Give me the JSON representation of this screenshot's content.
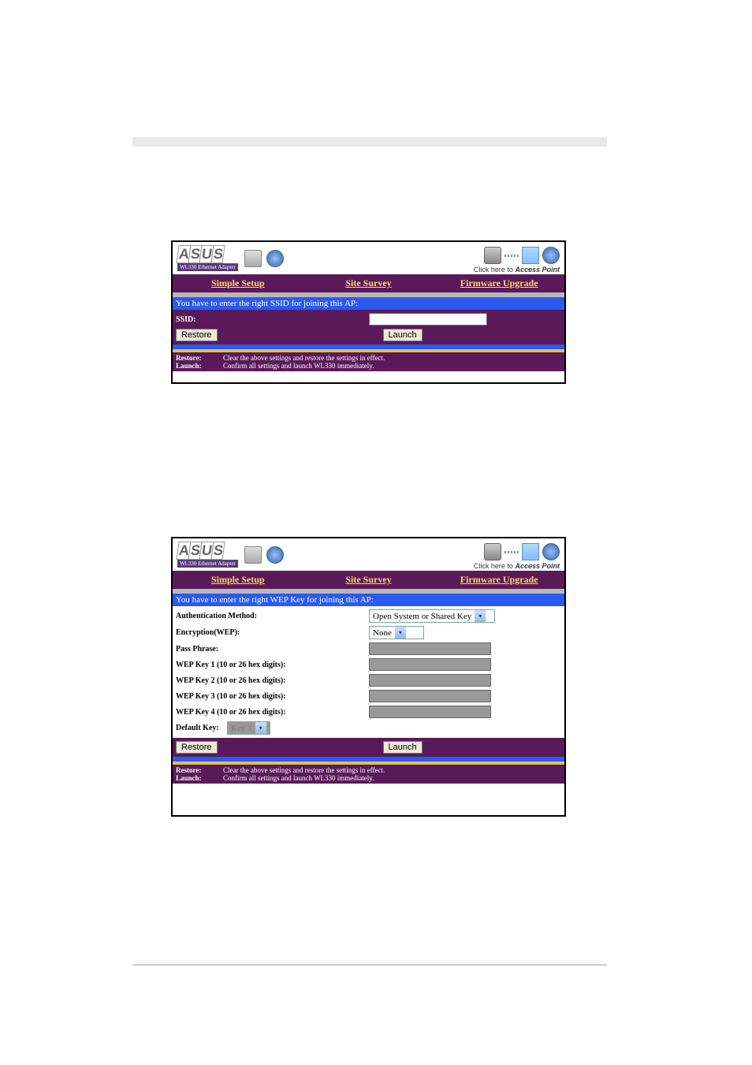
{
  "product_name": "WL330 Ethernet Adapter",
  "ap_link": "Click here to",
  "ap_link_bold": "Access Point",
  "tabs": [
    "Simple Setup",
    "Site Survey",
    "Firmware Upgrade"
  ],
  "s1": {
    "message": "You have to enter the right SSID for joining this AP:",
    "ssid_label": "SSID:",
    "restore_btn": "Restore",
    "launch_btn": "Launch"
  },
  "s2": {
    "message": "You have to enter the right WEP Key for joining this AP:",
    "auth_label": "Authentication Method:",
    "auth_value": "Open System or Shared Key",
    "enc_label": "Encryption(WEP):",
    "enc_value": "None",
    "pass_label": "Pass Phrase:",
    "wep_labels": [
      "WEP Key 1 (10 or 26 hex digits):",
      "WEP Key 2 (10 or 26 hex digits):",
      "WEP Key 3 (10 or 26 hex digits):",
      "WEP Key 4 (10 or 26 hex digits):"
    ],
    "default_key_label": "Default Key:",
    "default_key_value": "Key 1",
    "restore_btn": "Restore",
    "launch_btn": "Launch"
  },
  "footer": {
    "restore_label": "Restore:",
    "restore_text": "Clear the above settings and restore the settings in effect.",
    "launch_label": "Launch:",
    "launch_text": "Confirm all settings and launch WL330 immediately."
  }
}
